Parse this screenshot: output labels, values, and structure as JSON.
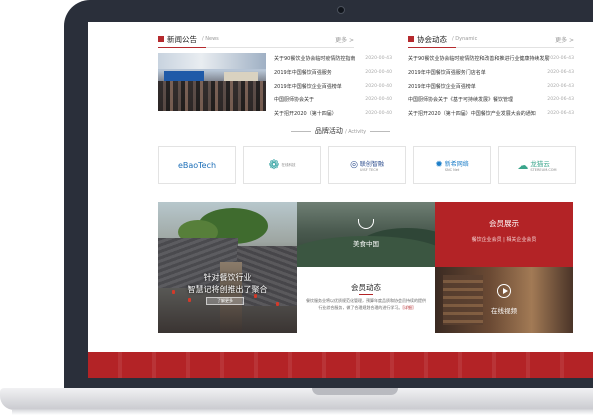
{
  "news": {
    "title": "新闻公告",
    "title_en": "/ News",
    "more": "更多 >",
    "items": [
      {
        "text": "关于90餐饮业协会临时疫情防控指南",
        "date": "2020-00-43"
      },
      {
        "text": "2019年中国餐饮百强服务",
        "date": "2020-00-40"
      },
      {
        "text": "2019年中国餐饮企业百强榜单",
        "date": "2020-00-40"
      },
      {
        "text": "中国厨师协会关于",
        "date": "2020-00-40"
      },
      {
        "text": "关于招开2020（第十四届）",
        "date": "2020-00-40"
      }
    ]
  },
  "dynamic": {
    "title": "协会动态",
    "title_en": "/ Dynamic",
    "more": "更多 >",
    "items": [
      {
        "text": "关于90餐饮业协会临时疫情防控和改善和推进行业健康持续发展",
        "date": "2020-06-43"
      },
      {
        "text": "2019年中国餐饮百强服务门店名单",
        "date": "2020-06-43"
      },
      {
        "text": "2019年中国餐饮企业百强榜单",
        "date": "2020-06-43"
      },
      {
        "text": "中国厨师协会关于《基于可持续发展》餐饮管理",
        "date": "2020-06-43"
      },
      {
        "text": "关于招开2020（第十四届）中国餐饮产业发展大会的通知",
        "date": "2020-06-43"
      }
    ]
  },
  "brand": {
    "title": "品牌活动",
    "title_en": "/ Activity",
    "logos": [
      {
        "name": "eBaoTech",
        "sub": ""
      },
      {
        "name": "在线科技",
        "sub": ""
      },
      {
        "name": "联创智融",
        "sub": "UISF TECH"
      },
      {
        "name": "新希网络",
        "sub": "SNC Net"
      },
      {
        "name": "龙猫云",
        "sub": "STEREUM.COM"
      }
    ]
  },
  "banner": {
    "caption_line1": "针对餐饮行业",
    "caption_line2": "智慧记将创推出了聚合",
    "button": "了解更多"
  },
  "tiles": {
    "food": "美食中国",
    "member_show": {
      "title": "会员展示",
      "sub": "餐饮企业会员  |  相关企业会员"
    },
    "member_news": {
      "title": "会员动态",
      "body": "餐饮服务业将以优质规范化管理，预算年度品质和协会员持续的提供行业综合服务，做了合理规划合理的进行学习。",
      "more": "[详细]"
    },
    "video": "在线视频"
  },
  "colors": {
    "accent": "#b32326",
    "laptop": "#2a2f3a"
  }
}
